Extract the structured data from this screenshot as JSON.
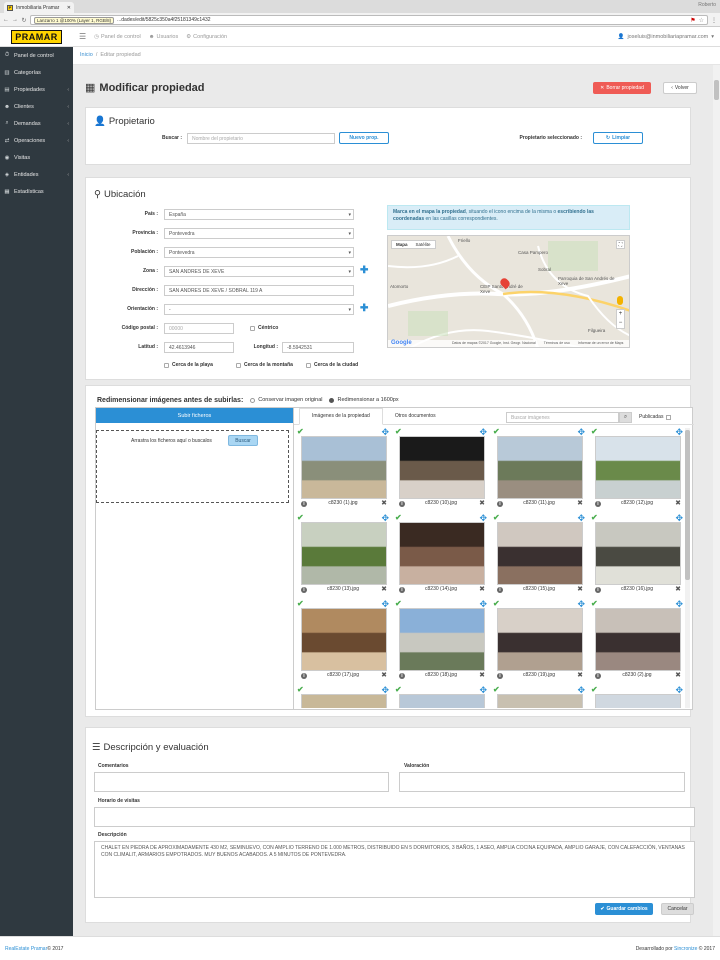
{
  "browser": {
    "tab_title": "Inmobiliaria Pramar",
    "window_user": "Roberto",
    "addr_chip": "Lanzarro 1 @100% (Layer 1, RGB/8)",
    "url": "...dades/edit/5825c350a4f25181349c1432"
  },
  "sidebar": {
    "logo": "PRAMAR",
    "items": [
      {
        "icon": "⏱",
        "label": "Panel de control",
        "chevron": ""
      },
      {
        "icon": "▥",
        "label": "Categorías",
        "chevron": ""
      },
      {
        "icon": "▤",
        "label": "Propiedades",
        "chevron": "‹"
      },
      {
        "icon": "☻",
        "label": "Clientes",
        "chevron": "‹"
      },
      {
        "icon": "⌕",
        "label": "Demandas",
        "chevron": "‹"
      },
      {
        "icon": "⇄",
        "label": "Operaciones",
        "chevron": "‹"
      },
      {
        "icon": "◉",
        "label": "Visitas",
        "chevron": ""
      },
      {
        "icon": "◈",
        "label": "Entidades",
        "chevron": "‹"
      },
      {
        "icon": "▦",
        "label": "Estadísticas",
        "chevron": ""
      }
    ]
  },
  "topbar": {
    "nav": [
      {
        "icon": "◷",
        "label": "Panel de control"
      },
      {
        "icon": "☻",
        "label": "Usuarios"
      },
      {
        "icon": "⚙",
        "label": "Configuración"
      }
    ],
    "user_email": "joseluis@inmobiliariapramar.com"
  },
  "breadcrumb": {
    "home": "Inicio",
    "sep": "/",
    "current": "Editar propiedad"
  },
  "page": {
    "title": "Modificar propiedad",
    "btn_borrar": "Borrar propiedad",
    "btn_volver": "Volver"
  },
  "propietario": {
    "title": "Propietario",
    "buscar_label": "Buscar :",
    "buscar_placeholder": "Nombre del propietario",
    "nuevo_btn": "Nuevo prop.",
    "seleccionado_label": "Propietario seleccionado :",
    "limpiar_btn": "Limpiar"
  },
  "ubicacion": {
    "title": "Ubicación",
    "pais_label": "País :",
    "pais": "España",
    "provincia_label": "Provincia :",
    "provincia": "Pontevedra",
    "poblacion_label": "Población :",
    "poblacion": "Pontevedra",
    "zona_label": "Zona :",
    "zona": "SAN ANDRES DE XEVE",
    "direccion_label": "Dirección :",
    "direccion": "SAN ANDRES DE XEVE / SOBRAL 119 A",
    "orientacion_label": "Orientación :",
    "orientacion": "-",
    "cp_label": "Código postal :",
    "cp_placeholder": "00000",
    "centrico": "Céntrico",
    "latitud_label": "Latitud :",
    "latitud": "42.4613946",
    "longitud_label": "Longitud :",
    "longitud": "-8.5942531",
    "cerca_playa": "Cerca de la playa",
    "cerca_montana": "Cerca de la montaña",
    "cerca_ciudad": "Cerca de la ciudad",
    "map_note_1": "Marca en el mapa la propiedad",
    "map_note_2": ", situando el icono encima de la misma o ",
    "map_note_3": "escribiendo las coordenadas",
    "map_note_4": " en las casillas correspondientes.",
    "map_type_mapa": "Mapa",
    "map_type_sat": "Satélite",
    "map_labels": [
      "Casa Pampero",
      "Sobral",
      "Parroquia de San Andrés de Xeve",
      "CEIP Santo André de Xeve",
      "Atomorto",
      "Filgueira",
      "Friello"
    ],
    "map_footer": [
      "Datos de mapas ©2017 Google, Inst. Geogr. Nacional",
      "Términos de uso",
      "Informar de un error de Maps"
    ],
    "google": "Google"
  },
  "imagenes": {
    "resize_title": "Redimensionar imágenes antes de subirlas:",
    "opt_original": "Conservar imagen original",
    "opt_1600": "Redimensionar a 1600px",
    "subir_tab": "Subir ficheros",
    "drop_text": "Arrastra los ficheros aquí o buscalos",
    "buscar_btn": "Buscar",
    "tab_imagenes": "Imágenes de la propiedad",
    "tab_otros": "Otros documentos",
    "search_placeholder": "Buscar imágenes",
    "publicadas": "Publicadas",
    "photos": [
      {
        "name": "c8230 (1).jpg",
        "colors": [
          "#a9c0d6",
          "#8a8f7a",
          "#c9b89a"
        ]
      },
      {
        "name": "c8230 (10).jpg",
        "colors": [
          "#1a1a1a",
          "#6a5a4a",
          "#d8d0c8"
        ]
      },
      {
        "name": "c8230 (11).jpg",
        "colors": [
          "#b8c9d8",
          "#6c7a5a",
          "#9a8e80"
        ]
      },
      {
        "name": "c8230 (12).jpg",
        "colors": [
          "#d8e2ea",
          "#6a8a4a",
          "#c8d0d0"
        ]
      },
      {
        "name": "c8230 (13).jpg",
        "colors": [
          "#c8d0c0",
          "#5a7a3a",
          "#b0b8a8"
        ]
      },
      {
        "name": "c8230 (14).jpg",
        "colors": [
          "#3a2a22",
          "#7a5a48",
          "#c8b0a0"
        ]
      },
      {
        "name": "c8230 (15).jpg",
        "colors": [
          "#d0c8c0",
          "#3a3030",
          "#8a7060"
        ]
      },
      {
        "name": "c8230 (16).jpg",
        "colors": [
          "#c8c8c0",
          "#4a4a42",
          "#e0e0d8"
        ]
      },
      {
        "name": "c8230 (17).jpg",
        "colors": [
          "#b08a60",
          "#6a4a30",
          "#d8c0a0"
        ]
      },
      {
        "name": "c8230 (18).jpg",
        "colors": [
          "#8ab0d8",
          "#c8c8c0",
          "#6a7a5a"
        ]
      },
      {
        "name": "c8230 (19).jpg",
        "colors": [
          "#d8d0c8",
          "#3a3030",
          "#b0a090"
        ]
      },
      {
        "name": "c8230 (2).jpg",
        "colors": [
          "#c8c0b8",
          "#3a3030",
          "#9a8880"
        ]
      },
      {
        "name": "",
        "colors": [
          "#c8b898",
          "#8a7050",
          "#d8d0c0"
        ]
      },
      {
        "name": "",
        "colors": [
          "#b8c8d8",
          "#5a5a50",
          "#c0c0b8"
        ]
      },
      {
        "name": "",
        "colors": [
          "#c8c0b0",
          "#6a5a48",
          "#d8d0c0"
        ]
      },
      {
        "name": "",
        "colors": [
          "#d0d8e0",
          "#8a9aa8",
          "#e0e4e8"
        ]
      }
    ]
  },
  "descripcion": {
    "title": "Descripción y evaluación",
    "comentarios_label": "Comentarios",
    "valoracion_label": "Valoración",
    "horario_label": "Horario de visitas",
    "descripcion_label": "Descripción",
    "descripcion_text": "CHALET EN PIEDRA DE APROXIMADAMENTE 430 M2, SEMINUEVO, CON AMPLIO TERRENO DE 1.000 METROS, DISTRIBUIDO EN 5 DORMITORIOS, 3 BAÑOS, 1 ASEO, AMPLIA COCINA EQUIPADA, AMPLIO GARAJE, CON CALEFACCIÓN, VENTANAS CON CLIMALIT, ARMARIOS EMPOTRADOS. MUY BUENOS ACABADOS. A 5 MINUTOS DE PONTEVEDRA.",
    "guardar_btn": "Guardar cambios",
    "cancelar_btn": "Cancelar"
  },
  "footer": {
    "left_brand": "RealEstate Pramar",
    "left_year": " © 2017",
    "right_pre": "Desarrollado por ",
    "right_brand": "Sincronize",
    "right_year": " © 2017"
  }
}
